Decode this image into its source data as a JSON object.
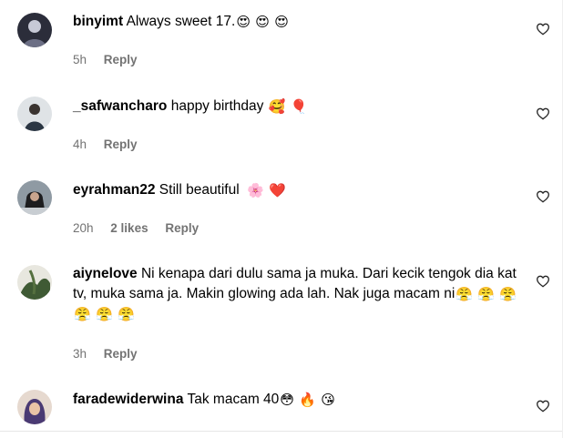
{
  "comments": [
    {
      "username": "binyimt",
      "text": "Always sweet 17.",
      "emojis": [
        "😍",
        "😍",
        "😍"
      ],
      "time": "5h",
      "likes": "",
      "reply_label": "Reply",
      "avatar_bg": "#2b2d3a",
      "avatar_fg": "#c7c9d6"
    },
    {
      "username": "_safwancharo",
      "text": "happy birthday",
      "emojis": [
        "🥰",
        "🎈"
      ],
      "time": "4h",
      "likes": "",
      "reply_label": "Reply",
      "avatar_bg": "#dfe3e6",
      "avatar_fg": "#2a3542"
    },
    {
      "username": "eyrahman22",
      "text": "Still beautiful",
      "emojis": [
        "🌸",
        "❤️"
      ],
      "time": "20h",
      "likes": "2 likes",
      "reply_label": "Reply",
      "avatar_bg": "#8f9aa3",
      "avatar_fg": "#1d1d1f"
    },
    {
      "username": "aiynelove",
      "text": "Ni kenapa dari dulu sama ja muka. Dari kecik tengok dia kat tv, muka sama ja. Makin glowing ada lah. Nak juga macam ni",
      "emojis": [
        "😤",
        "😤",
        "😤",
        "😤",
        "😤",
        "😤"
      ],
      "time": "3h",
      "likes": "",
      "reply_label": "Reply",
      "avatar_bg": "#e8e7df",
      "avatar_fg": "#3f5a34"
    },
    {
      "username": "faradewiderwina",
      "text": "Tak macam 40",
      "emojis": [
        "😳",
        "🔥",
        "😘"
      ],
      "time": "",
      "likes": "",
      "reply_label": "",
      "avatar_bg": "#e6d9cf",
      "avatar_fg": "#4a3a73"
    }
  ],
  "icons": {
    "like": "heart-outline-icon"
  },
  "colors": {
    "meta_text": "#737373",
    "text": "#000000",
    "background": "#ffffff"
  }
}
